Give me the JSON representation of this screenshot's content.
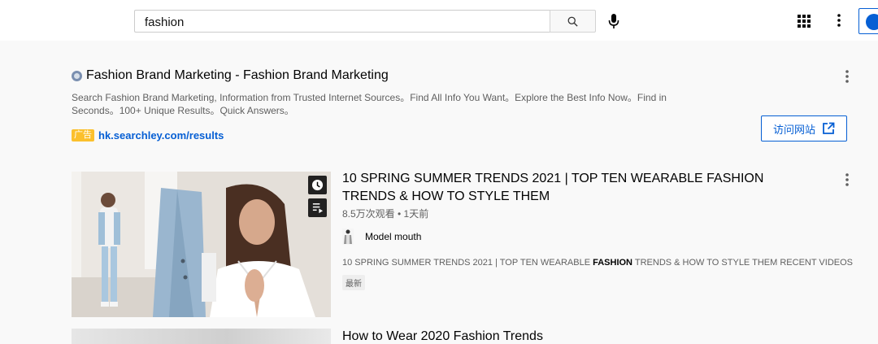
{
  "search": {
    "value": "fashion",
    "placeholder": ""
  },
  "icons": {
    "search": "search-icon",
    "mic": "mic-icon",
    "apps": "apps-grid-icon",
    "more": "more-vertical-icon",
    "external": "external-link-icon",
    "clock": "watch-later-icon",
    "queue": "add-to-queue-icon",
    "globe": "globe-icon"
  },
  "colors": {
    "accent": "#065fd4",
    "ad_badge": "#fbc02d"
  },
  "ad": {
    "title": "Fashion Brand Marketing - Fashion Brand Marketing",
    "description": "Search Fashion Brand Marketing, Information from Trusted Internet Sources。Find All Info You Want。Explore the Best Info Now。Find in Seconds。100+ Unique Results。Quick Answers。",
    "badge": "广告",
    "url": "hk.searchley.com/results",
    "visit_label": "访问网站"
  },
  "videos": [
    {
      "title": "10 SPRING SUMMER TRENDS 2021 | TOP TEN WEARABLE FASHION TRENDS & HOW TO STYLE THEM",
      "meta": "8.5万次观看 • 1天前",
      "channel": "Model mouth",
      "desc_before": "10 SPRING SUMMER TRENDS 2021 | TOP TEN WEARABLE ",
      "desc_bold": "FASHION",
      "desc_after": " TRENDS & HOW TO STYLE THEM RECENT VIDEOS ...",
      "badge": "最新"
    },
    {
      "title": "How to Wear 2020 Fashion Trends"
    }
  ]
}
